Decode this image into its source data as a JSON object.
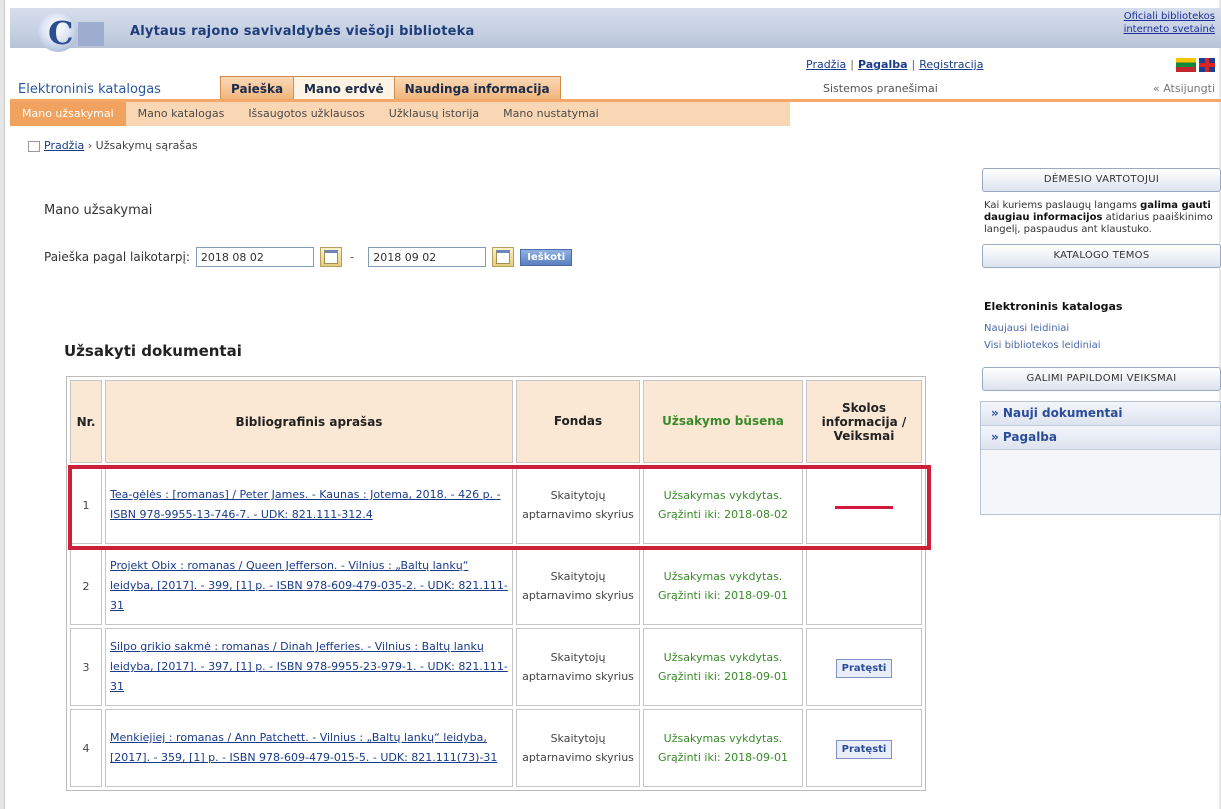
{
  "header": {
    "site_title": "Alytaus rajono savivaldybės viešoji biblioteka",
    "official_line1": "Oficiali bibliotekos",
    "official_line2": "interneto svetainė"
  },
  "top_links": {
    "home": "Pradžia",
    "help": "Pagalba",
    "register": "Registracija"
  },
  "system_messages": "Sistemos pranešimai",
  "login": "« Atsijungti",
  "catalog_label": "Elektroninis katalogas",
  "tabs": [
    "Paieška",
    "Mano erdvė",
    "Naudinga informacija"
  ],
  "subtabs": [
    "Mano užsakymai",
    "Mano katalogas",
    "Išsaugotos užklausos",
    "Užklausų istorija",
    "Mano nustatymai"
  ],
  "breadcrumb": {
    "home": "Pradžia",
    "current": "Užsakymų sąrašas"
  },
  "main": {
    "title": "Mano užsakymai",
    "filter_label": "Paieška pagal laikotarpį:",
    "date_from": "2018 08 02",
    "date_to": "2018 09 02",
    "search_button": "Ieškoti"
  },
  "docs_title": "Užsakyti dokumentai",
  "table": {
    "headers": [
      "Nr.",
      "Bibliografinis aprašas",
      "Fondas",
      "Užsakymo būsena",
      "Skolos informacija / Veiksmai"
    ],
    "rows": [
      {
        "nr": "1",
        "bib": "Tea-gėlės : [romanas] / Peter James. - Kaunas : Jotema, 2018. - 426 p. - ISBN 978-9955-13-746-7. - UDK: 821.111-312.4",
        "fond": "Skaitytojų aptarnavimo skyrius",
        "status": "Užsakymas vykdytas. Grąžinti iki: 2018-08-02",
        "action": ""
      },
      {
        "nr": "2",
        "bib": "Projekt Obix : romanas / Queen Jefferson. - Vilnius : „Baltų lankų“ leidyba, [2017]. - 399, [1] p. - ISBN 978-609-479-035-2. - UDK: 821.111-31",
        "fond": "Skaitytojų aptarnavimo skyrius",
        "status": "Užsakymas vykdytas. Grąžinti iki: 2018-09-01",
        "action": ""
      },
      {
        "nr": "3",
        "bib": "Silpo grikio sakmė : romanas / Dinah Jefferies. - Vilnius : Baltų lankų leidyba, [2017]. - 397, [1] p. - ISBN 978-9955-23-979-1. - UDK: 821.111-31",
        "fond": "Skaitytojų aptarnavimo skyrius",
        "status": "Užsakymas vykdytas. Grąžinti iki: 2018-09-01",
        "action": "Pratęsti"
      },
      {
        "nr": "4",
        "bib": "Menkiejiej : romanas / Ann Patchett. - Vilnius : „Baltų lankų“ leidyba, [2017]. - 359, [1] p. - ISBN 978-609-479-015-5. - UDK: 821.111(73)-31",
        "fond": "Skaitytojų aptarnavimo skyrius",
        "status": "Užsakymas vykdytas. Grąžinti iki: 2018-09-01",
        "action": "Pratęsti"
      }
    ]
  },
  "sidebar": {
    "btn_reader": "DĖMESIO VARTOTOJUI",
    "info_text_1": "Kai kuriems paslaugų langams",
    "info_bold": "galima gauti daugiau informacijos",
    "info_text_2": "atidarius paaiškinimo langelį, paspaudus ant klaustuko.",
    "btn_catalog": "KATALOGO TEMOS",
    "catalog_heading": "Elektroninis katalogas",
    "catalog_link_1": "Naujausi leidiniai",
    "catalog_link_2": "Visi bibliotekos leidiniai",
    "btn_options": "GALIMI PAPILDOMI VEIKSMAI",
    "menu_1": "» Nauji dokumentai",
    "menu_2": "» Pagalba"
  },
  "colors": {
    "accent_orange": "#f5a868",
    "highlight_red": "#cc1f3a",
    "status_green": "#3a8a2a"
  }
}
